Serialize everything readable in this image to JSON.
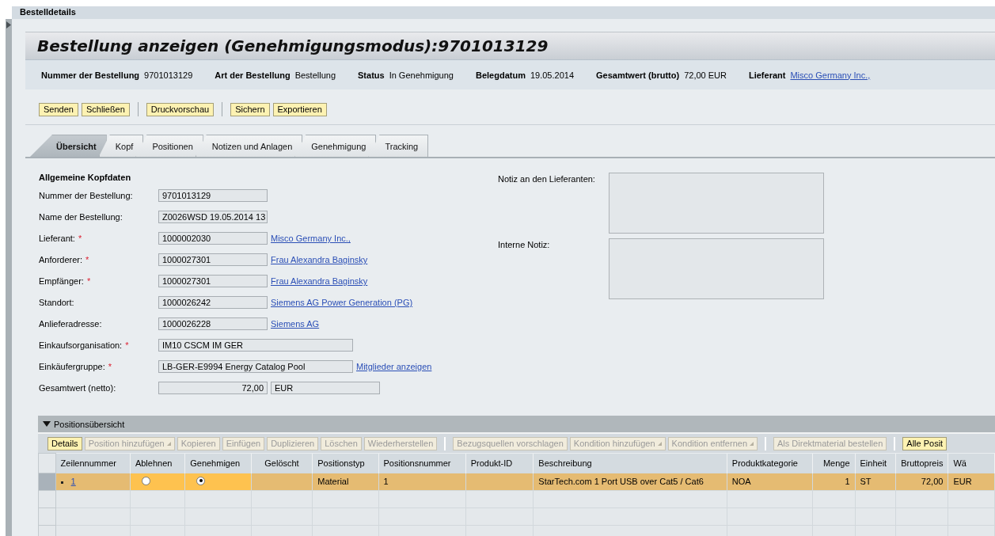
{
  "section_title": "Bestelldetails",
  "title": "Bestellung anzeigen (Genehmigungsmodus):9701013129",
  "info": [
    {
      "label": "Nummer der Bestellung",
      "value": "9701013129",
      "kind": "text"
    },
    {
      "label": "Art der Bestellung",
      "value": "Bestellung",
      "kind": "text"
    },
    {
      "label": "Status",
      "value": "In Genehmigung",
      "kind": "text"
    },
    {
      "label": "Belegdatum",
      "value": "19.05.2014",
      "kind": "text"
    },
    {
      "label": "Gesamtwert (brutto)",
      "value": "72,00 EUR",
      "kind": "text"
    },
    {
      "label": "Lieferant",
      "value": "Misco Germany Inc.,",
      "kind": "link"
    }
  ],
  "button_groups": [
    [
      "Senden",
      "Schließen"
    ],
    [
      "Druckvorschau"
    ],
    [
      "Sichern",
      "Exportieren"
    ]
  ],
  "tabs": [
    {
      "label": "Übersicht",
      "selected": true
    },
    {
      "label": "Kopf",
      "selected": false
    },
    {
      "label": "Positionen",
      "selected": false
    },
    {
      "label": "Notizen und Anlagen",
      "selected": false
    },
    {
      "label": "Genehmigung",
      "selected": false
    },
    {
      "label": "Tracking",
      "selected": false
    }
  ],
  "form": {
    "heading": "Allgemeine Kopfdaten",
    "fields": [
      {
        "label": "Nummer der Bestellung:",
        "kind": "id",
        "value": "9701013129"
      },
      {
        "label": "Name der Bestellung:",
        "kind": "id",
        "value": "Z0026WSD 19.05.2014 13"
      },
      {
        "label": "Lieferant:",
        "required_mark": "*",
        "kind": "id",
        "value": "1000002030",
        "link": "Misco Germany Inc.,"
      },
      {
        "label": "Anforderer:",
        "required_mark": "*",
        "kind": "id",
        "value": "1000027301",
        "link": "Frau Alexandra Baginsky"
      },
      {
        "label": "Empfänger:",
        "required_mark": "*",
        "kind": "id",
        "value": "1000027301",
        "link": "Frau Alexandra Baginsky"
      },
      {
        "label": "Standort:",
        "kind": "id",
        "value": "1000026242",
        "link": "Siemens AG Power Generation (PG)"
      },
      {
        "label": "Anlieferadresse:",
        "kind": "id",
        "value": "1000026228",
        "link": "Siemens AG"
      },
      {
        "label": "Einkaufsorganisation:",
        "required_mark": "*",
        "kind": "text",
        "value": "IM10 CSCM IM GER"
      },
      {
        "label": "Einkäufergruppe:",
        "required_mark": "*",
        "kind": "text",
        "value": "LB-GER-E9994 Energy Catalog Pool",
        "link": "Mitglieder anzeigen"
      },
      {
        "label": "Gesamtwert (netto):",
        "kind": "amount",
        "value": "72,00",
        "unit": "EUR"
      }
    ]
  },
  "notes": [
    {
      "label": "Notiz an den Lieferanten:"
    },
    {
      "label": "Interne Notiz:"
    }
  ],
  "positions": {
    "title": "Positionsübersicht",
    "expanded": true,
    "toolbar": [
      {
        "kind": "button",
        "label": "Details",
        "disabled": false,
        "dropdown": false
      },
      {
        "kind": "button",
        "label": "Position hinzufügen",
        "disabled": true,
        "dropdown": true
      },
      {
        "kind": "button",
        "label": "Kopieren",
        "disabled": true,
        "dropdown": false
      },
      {
        "kind": "button",
        "label": "Einfügen",
        "disabled": true,
        "dropdown": false
      },
      {
        "kind": "button",
        "label": "Duplizieren",
        "disabled": true,
        "dropdown": false
      },
      {
        "kind": "button",
        "label": "Löschen",
        "disabled": true,
        "dropdown": false
      },
      {
        "kind": "button",
        "label": "Wiederherstellen",
        "disabled": true,
        "dropdown": false
      },
      {
        "kind": "separator"
      },
      {
        "kind": "button",
        "label": "Bezugsquellen vorschlagen",
        "disabled": true,
        "dropdown": false
      },
      {
        "kind": "button",
        "label": "Kondition hinzufügen",
        "disabled": true,
        "dropdown": true
      },
      {
        "kind": "button",
        "label": "Kondition entfernen",
        "disabled": true,
        "dropdown": true
      },
      {
        "kind": "separator"
      },
      {
        "kind": "button",
        "label": "Als Direktmaterial bestellen",
        "disabled": true,
        "dropdown": false
      },
      {
        "kind": "separator"
      },
      {
        "kind": "button",
        "label": "Alle Posit",
        "disabled": false,
        "dropdown": false
      }
    ],
    "columns": [
      {
        "label": "Zeilennummer"
      },
      {
        "label": "Ablehnen"
      },
      {
        "label": "Genehmigen"
      },
      {
        "label": "Gelöscht"
      },
      {
        "label": "Positionstyp"
      },
      {
        "label": "Positionsnummer"
      },
      {
        "label": "Produkt-ID"
      },
      {
        "label": "Beschreibung"
      },
      {
        "label": "Produktkategorie"
      },
      {
        "label": "Menge"
      },
      {
        "label": "Einheit"
      },
      {
        "label": "Bruttopreis"
      },
      {
        "label": "Wä"
      }
    ],
    "rows": [
      {
        "selected": true,
        "cells": [
          {
            "kind": "link",
            "text": "1"
          },
          {
            "kind": "radio",
            "selected": false
          },
          {
            "kind": "radio",
            "selected": true
          },
          {
            "kind": "empty"
          },
          {
            "kind": "text",
            "text": "Material"
          },
          {
            "kind": "text",
            "text": "1"
          },
          {
            "kind": "empty"
          },
          {
            "kind": "text",
            "text": "StarTech.com 1 Port USB over Cat5 / Cat6"
          },
          {
            "kind": "text",
            "text": "NOA"
          },
          {
            "kind": "text",
            "text": "1"
          },
          {
            "kind": "text",
            "text": "ST"
          },
          {
            "kind": "text",
            "text": "72,00"
          },
          {
            "kind": "text",
            "text": "EUR"
          }
        ]
      }
    ]
  }
}
